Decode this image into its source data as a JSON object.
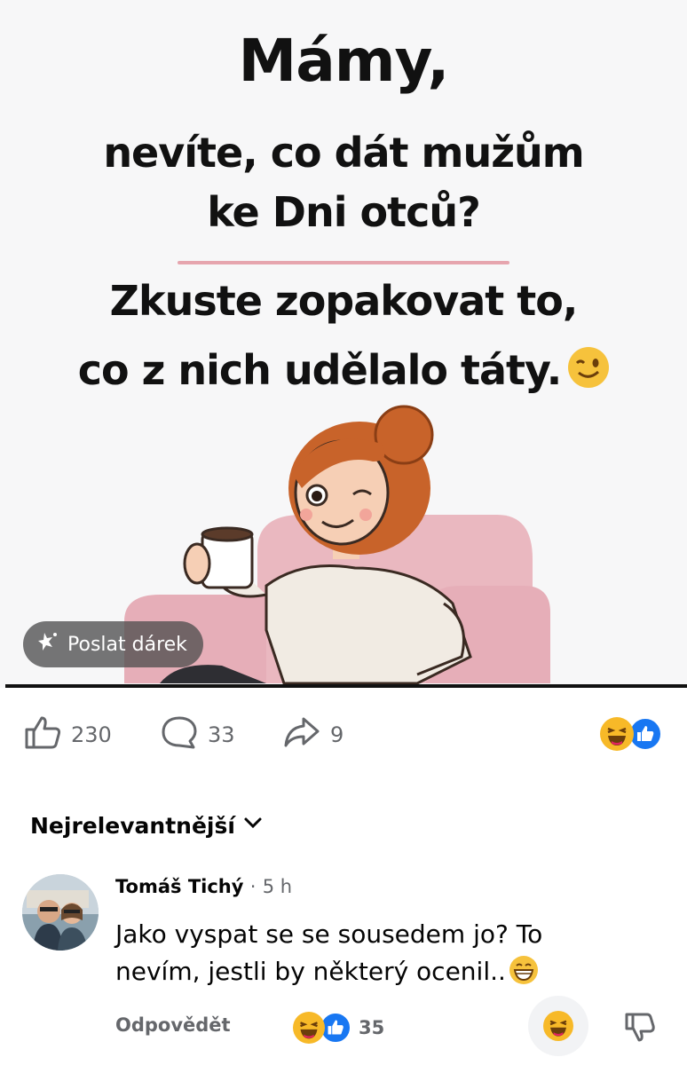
{
  "post": {
    "image": {
      "line1": "Mámy,",
      "line2": "nevíte, co dát mužům",
      "line3": "ke Dni otců?",
      "line4": "Zkuste zopakovat to,",
      "line5": "co z nich udělalo táty.",
      "gift_button_label": "Poslat dárek"
    },
    "stats": {
      "likes": "230",
      "comments": "33",
      "shares": "9"
    },
    "reactions": [
      "haha-icon",
      "like-icon"
    ]
  },
  "comments_section": {
    "sort_label": "Nejrelevantnější",
    "comments": [
      {
        "author": "Tomáš Tichý",
        "separator": "·",
        "time": "5 h",
        "text": "Jako vyspat se se sousedem jo? To nevím, jestli by některý ocenil..",
        "reply_label": "Odpovědět",
        "reaction_count": "35"
      }
    ]
  },
  "colors": {
    "facebook_blue": "#1877f2",
    "reaction_yellow": "#f7b928",
    "secondary_text": "#65676b",
    "accent_line": "#e6a5ae"
  }
}
